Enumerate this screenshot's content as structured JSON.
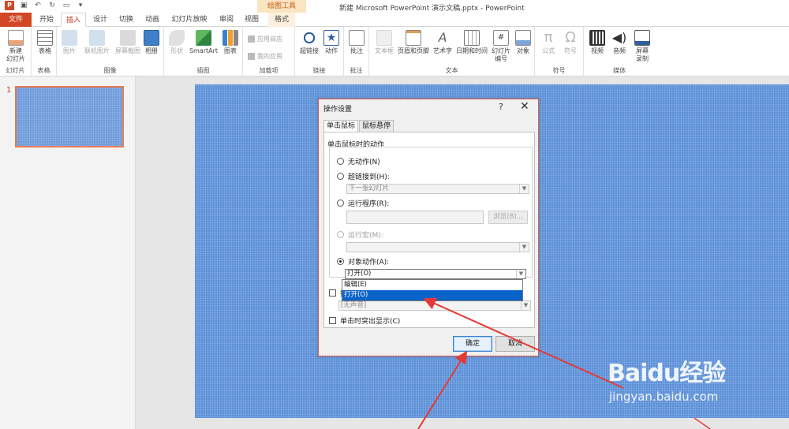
{
  "window": {
    "title": "新建 Microsoft PowerPoint 演示文稿.pptx - PowerPoint",
    "context_group": "绘图工具"
  },
  "tabs": [
    "文件",
    "开始",
    "插入",
    "设计",
    "切换",
    "动画",
    "幻灯片放映",
    "审阅",
    "视图",
    "格式"
  ],
  "active_tab": "插入",
  "ribbon": {
    "groups": {
      "slides": "幻灯片",
      "tables": "表格",
      "images": "图像",
      "illustrations": "插图",
      "addins": "加载项",
      "links": "链接",
      "comments": "批注",
      "text": "文本",
      "symbols": "符号",
      "media": "媒体"
    },
    "buttons": {
      "new_slide_1": "新建",
      "new_slide_2": "幻灯片",
      "table": "表格",
      "picture": "图片",
      "online_picture": "联机图片",
      "screenshot": "屏幕截图",
      "album": "相册",
      "shapes": "形状",
      "smartart": "SmartArt",
      "chart": "图表",
      "store": "应用商店",
      "my_apps": "我的应用",
      "hyperlink": "超链接",
      "action": "动作",
      "comment": "批注",
      "textbox": "文本框",
      "header_footer": "页眉和页脚",
      "wordart": "艺术字",
      "datetime": "日期和时间",
      "slide_number_1": "幻灯片",
      "slide_number_2": "编号",
      "object": "对象",
      "equation": "公式",
      "symbol": "符号",
      "video": "视频",
      "audio": "音频",
      "screen_rec_1": "屏幕",
      "screen_rec_2": "录制"
    }
  },
  "slide_panel": {
    "number": "1"
  },
  "dialog": {
    "title": "操作设置",
    "help": "?",
    "close": "✕",
    "tabs": [
      "单击鼠标",
      "鼠标悬停"
    ],
    "group_label": "单击鼠标时的动作",
    "options": {
      "none": "无动作(N)",
      "hyperlink": "超链接到(H):",
      "hyperlink_value": "下一张幻灯片",
      "run_program": "运行程序(R):",
      "browse": "浏览(B)...",
      "run_macro": "运行宏(M):",
      "object_action": "对象动作(A):",
      "object_action_value": "打开(O)"
    },
    "dropdown_items": [
      "编辑(E)",
      "打开(O)"
    ],
    "play_sound_partial": "播",
    "sound_value": "[无声音]",
    "highlight_click": "单击时突出显示(C)",
    "ok": "确定",
    "cancel": "取消"
  },
  "watermark": {
    "brand": "Baidu经验",
    "url": "jingyan.baidu.com"
  },
  "colors": {
    "accent": "#d24726",
    "slide_bg": "#5c8fd6",
    "dialog_border": "#e0574a",
    "arrow": "#e53935",
    "selection": "#0a63c9"
  }
}
